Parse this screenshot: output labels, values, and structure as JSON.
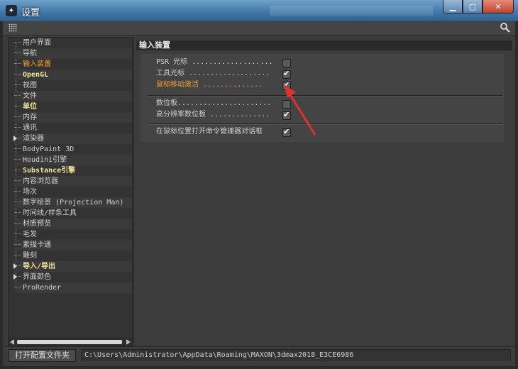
{
  "window": {
    "title": "设置",
    "controls": [
      "minimize",
      "maximize",
      "close"
    ]
  },
  "tree": {
    "items": [
      {
        "label": "用户界面",
        "state": "normal"
      },
      {
        "label": "导航",
        "state": "normal"
      },
      {
        "label": "输入装置",
        "state": "active"
      },
      {
        "label": "OpenGL",
        "state": "bold"
      },
      {
        "label": "视图",
        "state": "normal"
      },
      {
        "label": "文件",
        "state": "normal"
      },
      {
        "label": "单位",
        "state": "bold"
      },
      {
        "label": "内存",
        "state": "normal"
      },
      {
        "label": "通讯",
        "state": "normal"
      },
      {
        "label": "渲染器",
        "state": "normal",
        "expandable": true
      },
      {
        "label": "BodyPaint 3D",
        "state": "normal"
      },
      {
        "label": "Houdini引擎",
        "state": "normal"
      },
      {
        "label": "Substance引擎",
        "state": "bold"
      },
      {
        "label": "内容浏览器",
        "state": "normal"
      },
      {
        "label": "场次",
        "state": "normal"
      },
      {
        "label": "数字绘景 (Projection Man)",
        "state": "normal"
      },
      {
        "label": "时间线/样条工具",
        "state": "normal"
      },
      {
        "label": "材质预览",
        "state": "normal"
      },
      {
        "label": "毛发",
        "state": "normal"
      },
      {
        "label": "素描卡通",
        "state": "normal"
      },
      {
        "label": "雕刻",
        "state": "normal"
      },
      {
        "label": "导入/导出",
        "state": "bold",
        "expandable": true
      },
      {
        "label": "界面颜色",
        "state": "normal",
        "expandable": true
      },
      {
        "label": "ProRender",
        "state": "normal"
      }
    ]
  },
  "panel": {
    "header": "输入装置",
    "group1": [
      {
        "label": "PSR 光标 ...................",
        "checked": false,
        "highlight": false
      },
      {
        "label": "工具光标 ...................",
        "checked": true,
        "highlight": false
      },
      {
        "label": "鼠标移动激活 ..............",
        "checked": true,
        "highlight": true
      }
    ],
    "group2": [
      {
        "label": "数位板......................",
        "checked": false
      },
      {
        "label": "高分辨率数位板 ..............",
        "checked": true
      }
    ],
    "group3": [
      {
        "label": "在鼠标位置打开命令管理器对话框",
        "checked": true
      }
    ]
  },
  "footer": {
    "open_folder_button": "打开配置文件夹",
    "path": "C:\\Users\\Administrator\\AppData\\Roaming\\MAXON\\3dmax2018_E3CE6986"
  },
  "colors": {
    "accent": "#f0a030",
    "bold_item": "#f2e49a",
    "annotation": "#e03030"
  }
}
